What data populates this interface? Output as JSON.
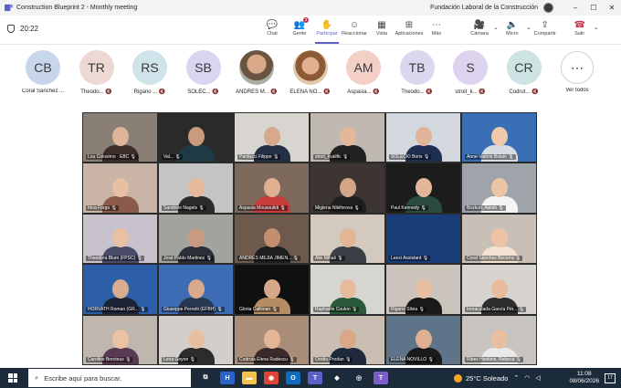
{
  "window": {
    "title": "Construction Blueprint 2 - Monthly meeting",
    "org": "Fundación Laboral de la Construcción",
    "controls": [
      "–",
      "☐",
      "✕"
    ]
  },
  "toolbar": {
    "timer": "20:22",
    "items": [
      {
        "label": "Chat",
        "icon": "chat-icon",
        "glyph": "💬"
      },
      {
        "label": "Gente",
        "icon": "people-icon",
        "glyph": "👥",
        "badge": "3"
      },
      {
        "label": "Participar",
        "icon": "hand-icon",
        "glyph": "✋"
      },
      {
        "label": "Reaccionar",
        "icon": "smile-icon",
        "glyph": "☺"
      },
      {
        "label": "Vista",
        "icon": "grid-icon",
        "glyph": "▦"
      },
      {
        "label": "Aplicaciones",
        "icon": "plus-icon",
        "glyph": "⊞"
      },
      {
        "label": "Más",
        "icon": "more-icon",
        "glyph": "⋯"
      }
    ],
    "media": [
      {
        "label": "Cámara",
        "icon": "camera-off-icon",
        "glyph": "🎥"
      },
      {
        "label": "Micro",
        "icon": "mic-icon",
        "glyph": "🔈"
      },
      {
        "label": "Compartir",
        "icon": "share-icon",
        "glyph": "⇪"
      },
      {
        "label": "Salir",
        "icon": "leave-icon",
        "glyph": "☎"
      }
    ]
  },
  "strip": [
    {
      "initials": "CB",
      "name": "Coral Sánchez ...",
      "color": "#c7d6ea"
    },
    {
      "initials": "TR",
      "name": "Theodo... 🔇",
      "color": "#eed8d4"
    },
    {
      "initials": "RS",
      "name": "Rigano ... 🔇",
      "color": "#cfe3ea"
    },
    {
      "initials": "SB",
      "name": "SOLEC... 🔇",
      "color": "#d9d4ef"
    },
    {
      "initials": "",
      "name": "ANDRES M... 🔇",
      "color": "photo"
    },
    {
      "initials": "",
      "name": "ELENA NO... 🔇",
      "color": "photo2"
    },
    {
      "initials": "AM",
      "name": "Aspasia... 🔇",
      "color": "#f3cfc6"
    },
    {
      "initials": "TB",
      "name": "Theodo... 🔇",
      "color": "#dcd6ef"
    },
    {
      "initials": "S",
      "name": "stroit_k... 🔇",
      "color": "#ddd3ef"
    },
    {
      "initials": "CR",
      "name": "Codrut... 🔇",
      "color": "#cde3e4"
    }
  ],
  "see_all": "Ver todos",
  "tiles": [
    {
      "name": "Lou Colosimo · EBC 🎙",
      "bg": "#8a7f74",
      "skin": "#e0b49a",
      "cloth": "#3a2d2a"
    },
    {
      "name": "Val...  🎙",
      "bg": "#2a2a2a",
      "skin": "#c99a7e",
      "cloth": "#1f3a44"
    },
    {
      "name": "Parducci Filippo 🎙",
      "bg": "#d8d4cf",
      "skin": "#d6a98d",
      "cloth": "#243046"
    },
    {
      "name": "stroit_kvalific 🎙",
      "bg": "#bfb9b2",
      "skin": "#e3b79b",
      "cloth": "#222222"
    },
    {
      "name": "SOLECKI Boris 🎙",
      "bg": "#d2d8de",
      "skin": "#e1b49a",
      "cloth": "#1e2f52"
    },
    {
      "name": "Anne-Valérie Bolain 🎙",
      "bg": "#3a6fb6",
      "skin": "#f0c8ac",
      "cloth": "#d7dbe4"
    },
    {
      "name": "Irina Forgo 🎙",
      "bg": "#c9b4a6",
      "skin": "#e8bfa3",
      "cloth": "#8a5a4a"
    },
    {
      "name": "Sandrine Nagels 🎙",
      "bg": "#c4c4c4",
      "skin": "#e5b99c",
      "cloth": "#2b2b2b"
    },
    {
      "name": "Aspasia Mousoulidi 🎙",
      "bg": "#7d6a5c",
      "skin": "#e0b092",
      "cloth": "#c73b3b"
    },
    {
      "name": "Miglena Nikiforova 🎙",
      "bg": "#3c3531",
      "skin": "#d5a58a",
      "cloth": "#1e1e1e"
    },
    {
      "name": "Paul Kennedy 🎙",
      "bg": "#1c1c1c",
      "skin": "#e3b69a",
      "cloth": "#2a4a3e"
    },
    {
      "name": "Bozkurt, Askim 🎙",
      "bg": "#9ea4a9",
      "skin": "#ecc5a5",
      "cloth": "#f4f4f4"
    },
    {
      "name": "Theodora Blum (FPSC) 🎙",
      "bg": "#c8c2cc",
      "skin": "#e8c0a4",
      "cloth": "#4a4a6a"
    },
    {
      "name": "José Pablo Martinez 🎙",
      "bg": "#a0a39e",
      "skin": "#c99a7f",
      "cloth": "#2a2f3a"
    },
    {
      "name": "ANDRES MEJIA JIMEN... 🎙",
      "bg": "#6e5a4c",
      "skin": "#c48e70",
      "cloth": "#1e1e1e"
    },
    {
      "name": "Alin Mihali 🎙",
      "bg": "#d3c9be",
      "skin": "#e2b595",
      "cloth": "#3a3f45"
    },
    {
      "name": "Leexi Assistant 🎙",
      "bg": "#1a3e7a",
      "skin": "#1a3e7a",
      "cloth": "#1a3e7a"
    },
    {
      "name": "Coral Sánchez Becerra 🎙",
      "bg": "#c8bfb6",
      "skin": "#eec3a5",
      "cloth": "#f4e3d3"
    },
    {
      "name": "HORVATH Roman (GR... 🎙",
      "bg": "#2d5ea8",
      "skin": "#d9ac90",
      "cloth": "#1c2438"
    },
    {
      "name": "Giuseppe Perretti (EFBH) 🎙",
      "bg": "#3f6db5",
      "skin": "#d8a98a",
      "cloth": "#283852"
    },
    {
      "name": "Gloria Calliman 🎙",
      "bg": "#101010",
      "skin": "#d7a78a",
      "cloth": "#b58d62"
    },
    {
      "name": "Raphaële Coulon 🎙",
      "bg": "#d6d6d0",
      "skin": "#e6bb9d",
      "cloth": "#2a5a3a"
    },
    {
      "name": "Rigano Silvia 🎙",
      "bg": "#cbc4bc",
      "skin": "#e9bea0",
      "cloth": "#1a1a1a"
    },
    {
      "name": "Inmaculada García Pér... 🎙",
      "bg": "#d7d3cf",
      "skin": "#e8bb9c",
      "cloth": "#2e2e2e"
    },
    {
      "name": "Caroline Brecteux 🎙",
      "bg": "#bfb6ad",
      "skin": "#ecc2a4",
      "cloth": "#5a3a52"
    },
    {
      "name": "Lena Goyon 🎙",
      "bg": "#d2cfcb",
      "skin": "#e8bfa1",
      "cloth": "#2c2c2c"
    },
    {
      "name": "Codruta Elena Radescu 🎙",
      "bg": "#a98d78",
      "skin": "#e4b596",
      "cloth": "#3a2a2a"
    },
    {
      "name": "Ovidiu Prodan 🎙",
      "bg": "#c9beb1",
      "skin": "#d8a889",
      "cloth": "#1f2a3c"
    },
    {
      "name": "ELENA NOVILLO 🎙",
      "bg": "#5e7488",
      "skin": "#dfb093",
      "cloth": "#1a1a1a"
    },
    {
      "name": "Ribes Hankins, Rebeca 🎙",
      "bg": "#c7c4c0",
      "skin": "#eabf9f",
      "cloth": "#e9e9e9"
    }
  ],
  "taskbar": {
    "search_placeholder": "Escribe aquí para buscar.",
    "weather": "25°C  Soleado",
    "time": "11:08",
    "date": "08/06/2026",
    "notifications": "17",
    "apps": [
      {
        "icon": "task-view-icon",
        "glyph": "⧉",
        "color": "#1c2b3a"
      },
      {
        "icon": "h-app-icon",
        "glyph": "H",
        "color": "#2a62c9"
      },
      {
        "icon": "file-explorer-icon",
        "glyph": "▬",
        "color": "#f2c14e"
      },
      {
        "icon": "chrome-icon",
        "glyph": "◉",
        "color": "#db4437"
      },
      {
        "icon": "outlook-icon",
        "glyph": "O",
        "color": "#0f6cbd"
      },
      {
        "icon": "teams-icon",
        "glyph": "T",
        "color": "#5b5fc7"
      },
      {
        "icon": "cube-app-icon",
        "glyph": "◆",
        "color": "#1c2b3a"
      },
      {
        "icon": "camera-app-icon",
        "glyph": "◎",
        "color": "#1c2b3a"
      },
      {
        "icon": "teams-active-icon",
        "glyph": "T",
        "color": "#7b5fc7"
      }
    ]
  }
}
